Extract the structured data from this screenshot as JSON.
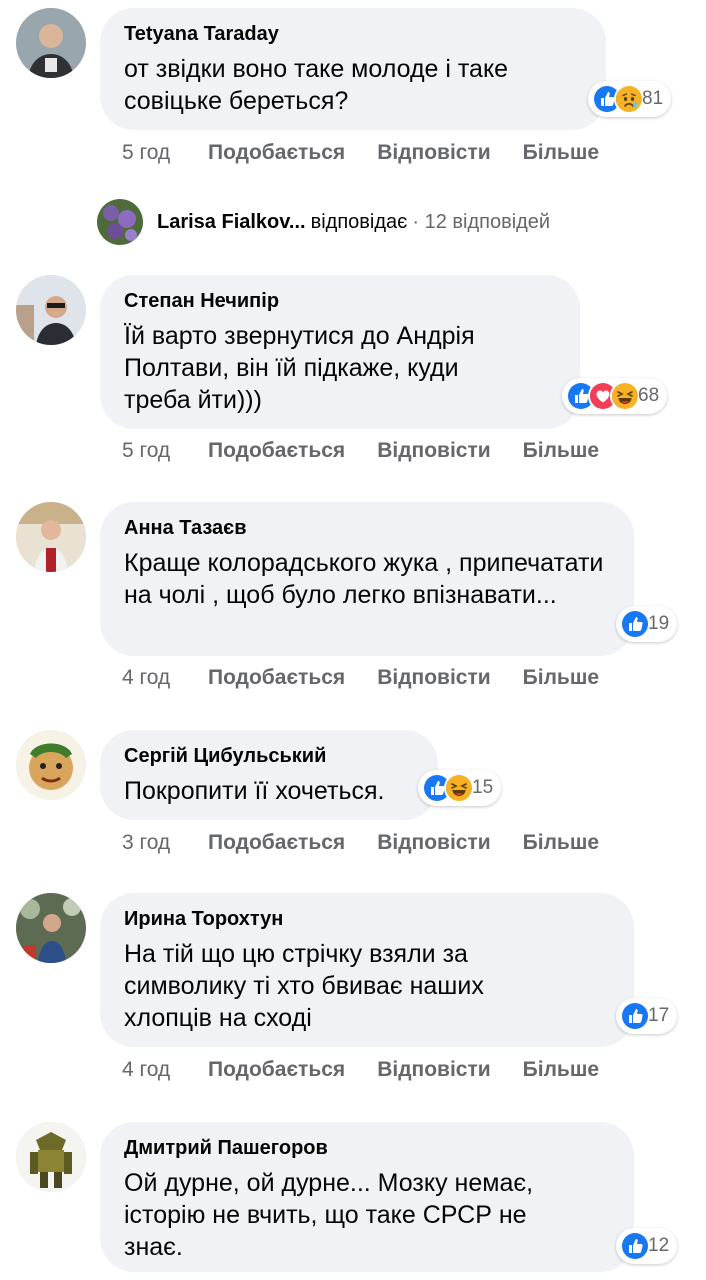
{
  "actions": {
    "like": "Подобається",
    "reply": "Відповісти",
    "more": "Більше"
  },
  "colors": {
    "like_blue": "#1877f2",
    "love_red": "#f33e58",
    "haha_yellow": "#f7b125",
    "bubble_bg": "#f0f2f5",
    "meta_gray": "#65676b"
  },
  "comments": [
    {
      "author": "Tetyana Taraday",
      "text": "от звідки воно таке молоде і таке совіцьке береться?",
      "reactions": [
        "like-icon",
        "sad-icon"
      ],
      "count": "81",
      "time": "5 год"
    },
    {
      "author": "Степан Нечипір",
      "text": "Їй варто звернутися до Андрія Полтави, він їй підкаже, куди треба йти)))",
      "reactions": [
        "like-icon",
        "love-icon",
        "haha-icon"
      ],
      "count": "68",
      "time": "5 год"
    },
    {
      "author": "Анна Тазаєв",
      "text": "Краще колорадського жука , припечатати на чолі , щоб було легко впізнавати...",
      "reactions": [
        "like-icon"
      ],
      "count": "19",
      "time": "4 год"
    },
    {
      "author": "Сергій Цибульський",
      "text": "Покропити її хочеться.",
      "reactions": [
        "like-icon",
        "haha-icon"
      ],
      "count": "15",
      "time": "3 год"
    },
    {
      "author": "Ирина Торохтун",
      "text": "На тій що цю стрічку взяли за символику ті хто бвиває наших хлопців на сході",
      "reactions": [
        "like-icon"
      ],
      "count": "17",
      "time": "4 год"
    },
    {
      "author": "Дмитрий Пашегоров",
      "text": "Ой дурне, ой дурне... Мозку немає, історію не вчить, що таке СРСР не знає.",
      "reactions": [
        "like-icon"
      ],
      "count": "12",
      "time": ""
    }
  ],
  "replies_row": {
    "name": "Larisa Fialkov...",
    "verb": "відповідає",
    "count_text": "· 12 відповідей"
  }
}
